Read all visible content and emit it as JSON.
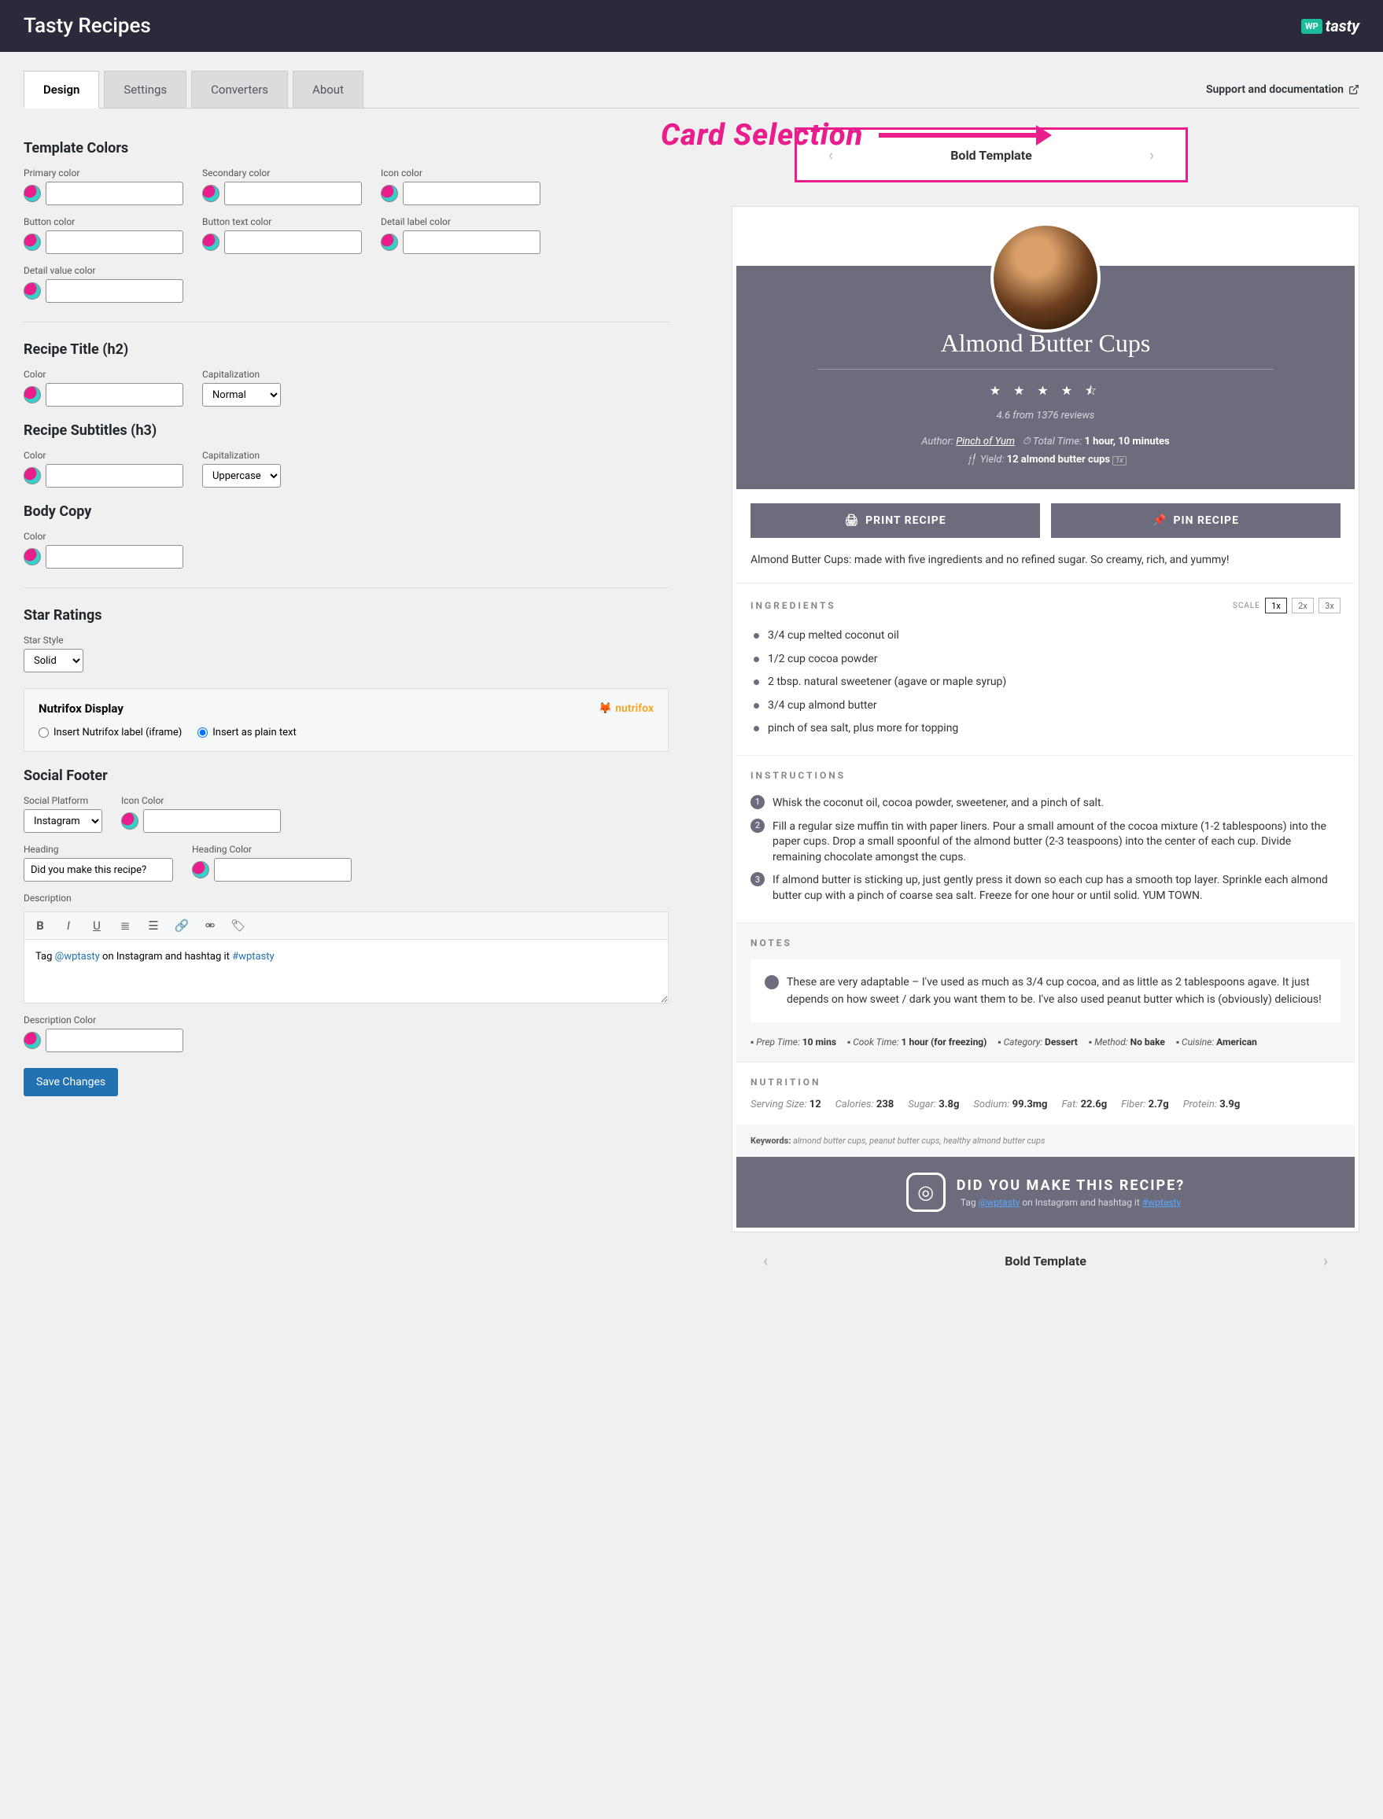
{
  "topbar": {
    "title": "Tasty Recipes",
    "logo_prefix": "WP",
    "logo_text": "tasty"
  },
  "tabs": [
    "Design",
    "Settings",
    "Converters",
    "About"
  ],
  "support_link": "Support and documentation",
  "annotation": "Card Selection",
  "card_selector": {
    "title": "Bold Template"
  },
  "sections": {
    "template_colors": {
      "title": "Template Colors",
      "fields": [
        "Primary color",
        "Secondary color",
        "Icon color",
        "Button color",
        "Button text color",
        "Detail label color",
        "Detail value color"
      ]
    },
    "recipe_title": {
      "title": "Recipe Title (h2)",
      "color_label": "Color",
      "cap_label": "Capitalization",
      "cap_value": "Normal"
    },
    "recipe_subtitles": {
      "title": "Recipe Subtitles (h3)",
      "color_label": "Color",
      "cap_label": "Capitalization",
      "cap_value": "Uppercase"
    },
    "body_copy": {
      "title": "Body Copy",
      "color_label": "Color"
    },
    "star": {
      "title": "Star Ratings",
      "style_label": "Star Style",
      "style_value": "Solid"
    },
    "nutrifox": {
      "title": "Nutrifox Display",
      "logo": "nutrifox",
      "opt1": "Insert Nutrifox label (iframe)",
      "opt2": "Insert as plain text"
    },
    "social_footer": {
      "title": "Social Footer",
      "platform_label": "Social Platform",
      "platform_value": "Instagram",
      "iconcolor_label": "Icon Color",
      "heading_label": "Heading",
      "heading_value": "Did you make this recipe?",
      "headingcolor_label": "Heading Color",
      "desc_label": "Description",
      "desc_pre": "Tag ",
      "desc_link1": "@wptasty",
      "desc_mid": " on Instagram and hashtag it ",
      "desc_link2": "#wptasty",
      "desccolor_label": "Description Color"
    }
  },
  "save_btn": "Save Changes",
  "recipe": {
    "title": "Almond Butter Cups",
    "stars": "★ ★ ★ ★ ⯪",
    "rating_text": "4.6 from 1376 reviews",
    "author_label": "Author:",
    "author": "Pinch of Yum",
    "total_label": "Total Time:",
    "total": "1 hour, 10 minutes",
    "yield_label": "Yield:",
    "yield": "12 almond butter cups",
    "print_btn": "PRINT RECIPE",
    "pin_btn": "PIN RECIPE",
    "description": "Almond Butter Cups: made with five ingredients and no refined sugar. So creamy, rich, and yummy!",
    "ing_title": "INGREDIENTS",
    "scale_label": "SCALE",
    "scales": [
      "1x",
      "2x",
      "3x"
    ],
    "ingredients": [
      "3/4 cup melted coconut oil",
      "1/2 cup cocoa powder",
      "2 tbsp. natural sweetener (agave or maple syrup)",
      "3/4 cup almond butter",
      "pinch of sea salt, plus more for topping"
    ],
    "instr_title": "INSTRUCTIONS",
    "instructions": [
      "Whisk the coconut oil, cocoa powder, sweetener, and a pinch of salt.",
      "Fill a regular size muffin tin with paper liners. Pour a small amount of the cocoa mixture (1-2 tablespoons) into the paper cups. Drop a small spoonful of the almond butter (2-3 teaspoons) into the center of each cup. Divide remaining chocolate amongst the cups.",
      "If almond butter is sticking up, just gently press it down so each cup has a smooth top layer. Sprinkle each almond butter cup with a pinch of coarse sea salt. Freeze for one hour or until solid. YUM TOWN."
    ],
    "notes_title": "NOTES",
    "note": "These are very adaptable – I've used as much as 3/4 cup cocoa, and as little as 2 tablespoons agave. It just depends on how sweet / dark you want them to be. I've also used peanut butter which is (obviously) delicious!",
    "tiny": [
      {
        "label": "Prep Time:",
        "val": "10 mins"
      },
      {
        "label": "Cook Time:",
        "val": "1 hour (for freezing)"
      },
      {
        "label": "Category:",
        "val": "Dessert"
      },
      {
        "label": "Method:",
        "val": "No bake"
      },
      {
        "label": "Cuisine:",
        "val": "American"
      }
    ],
    "nutrition_title": "NUTRITION",
    "nutrition": [
      {
        "label": "Serving Size:",
        "val": "12"
      },
      {
        "label": "Calories:",
        "val": "238"
      },
      {
        "label": "Sugar:",
        "val": "3.8g"
      },
      {
        "label": "Sodium:",
        "val": "99.3mg"
      },
      {
        "label": "Fat:",
        "val": "22.6g"
      },
      {
        "label": "Fiber:",
        "val": "2.7g"
      },
      {
        "label": "Protein:",
        "val": "3.9g"
      }
    ],
    "kw_label": "Keywords:",
    "kw": "almond butter cups, peanut butter cups, healthy almond butter cups",
    "social_heading": "DID YOU MAKE THIS RECIPE?",
    "social_pre": "Tag ",
    "social_link1": "@wptasty",
    "social_mid": " on Instagram and hashtag it ",
    "social_link2": "#wptasty"
  },
  "bottom_nav": "Bold Template"
}
